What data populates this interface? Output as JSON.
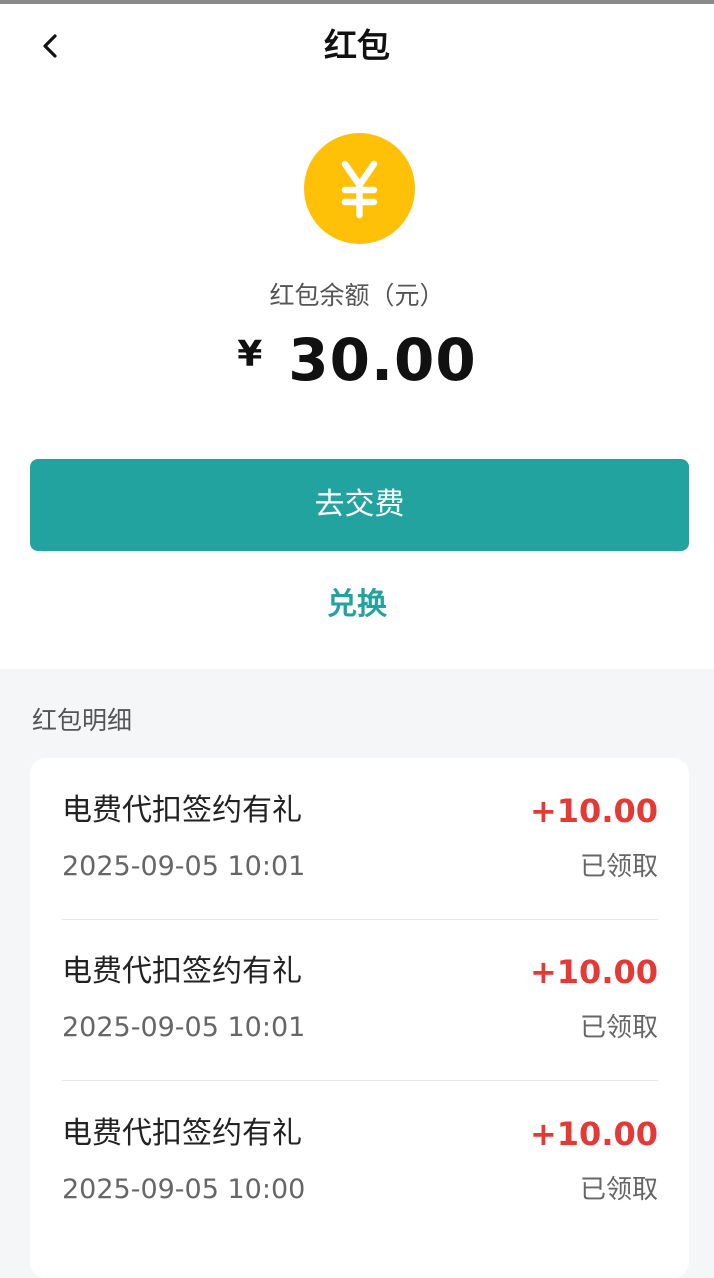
{
  "header": {
    "title": "红包",
    "back_icon": "chevron-left-icon"
  },
  "balance": {
    "icon": "yen-coin-icon",
    "icon_color": "#ffc107",
    "label": "红包余额（元）",
    "currency_symbol": "¥",
    "amount": "30.00"
  },
  "actions": {
    "pay_label": "去交费",
    "exchange_label": "兑换",
    "accent_color": "#22a39f"
  },
  "details": {
    "section_title": "红包明细",
    "amount_color": "#e53935",
    "records": [
      {
        "title": "电费代扣签约有礼",
        "amount": "+10.00",
        "time": "2025-09-05 10:01",
        "status": "已领取"
      },
      {
        "title": "电费代扣签约有礼",
        "amount": "+10.00",
        "time": "2025-09-05 10:01",
        "status": "已领取"
      },
      {
        "title": "电费代扣签约有礼",
        "amount": "+10.00",
        "time": "2025-09-05 10:00",
        "status": "已领取"
      }
    ]
  }
}
